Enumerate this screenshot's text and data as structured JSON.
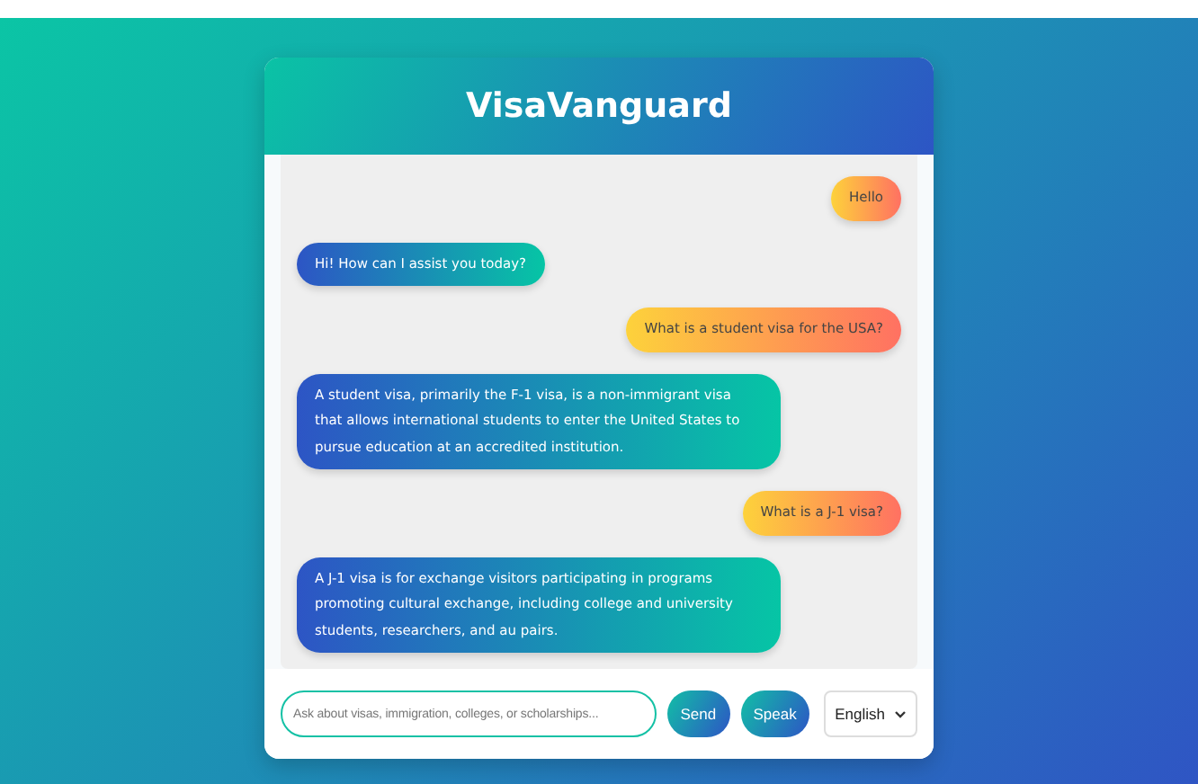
{
  "header": {
    "title": "VisaVanguard"
  },
  "messages": [
    {
      "kind": "user",
      "text": "Hello"
    },
    {
      "kind": "bot",
      "text": "Hi! How can I assist you today?"
    },
    {
      "kind": "user",
      "text": "What is a student visa for the USA?"
    },
    {
      "kind": "bot",
      "text": "A student visa, primarily the F-1 visa, is a non-immigrant visa that allows international students to enter the United States to pursue education at an accredited institution."
    },
    {
      "kind": "user",
      "text": "What is a J-1 visa?"
    },
    {
      "kind": "bot",
      "text": "A J-1 visa is for exchange visitors participating in programs promoting cultural exchange, including college and university students, researchers, and au pairs."
    }
  ],
  "input": {
    "placeholder": "Ask about visas, immigration, colleges, or scholarships..."
  },
  "buttons": [
    "Send",
    "Speak"
  ],
  "language": {
    "value": "English"
  }
}
